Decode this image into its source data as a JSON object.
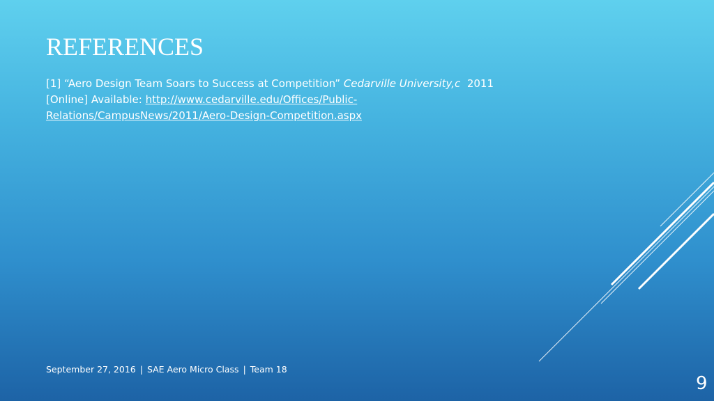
{
  "slide": {
    "title": "REFERENCES",
    "reference": {
      "line1_prefix": "[1] “Aero Design Team Soars to Success at Competition” ",
      "line1_source": "Cedarville University,c",
      "line1_year": "  2011",
      "line2_prefix": "[Online] Available: ",
      "url_part1": "http://www.cedarville.edu/Offices/Public-",
      "url_part2": "Relations/CampusNews/2011/Aero-Design-Competition.aspx"
    },
    "footer": {
      "date": "September 27, 2016",
      "separator": "|",
      "course": "SAE Aero Micro Class",
      "team": "Team 18"
    },
    "page_number": "9"
  }
}
